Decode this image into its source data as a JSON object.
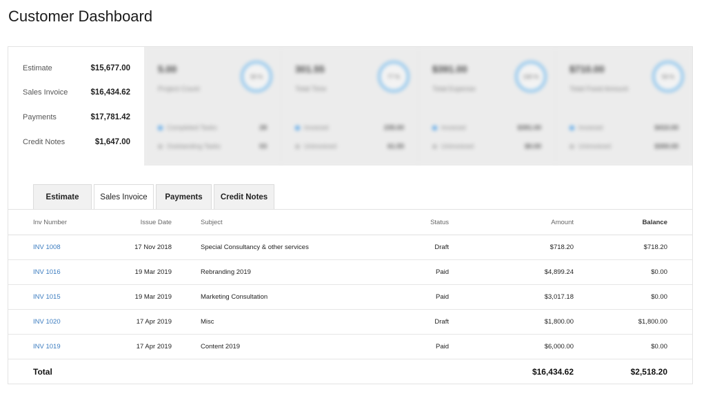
{
  "page": {
    "title": "Customer Dashboard"
  },
  "summary": [
    {
      "label": "Estimate",
      "value": "$15,677.00"
    },
    {
      "label": "Sales Invoice",
      "value": "$16,434.62"
    },
    {
      "label": "Payments",
      "value": "$17,781.42"
    },
    {
      "label": "Credit Notes",
      "value": "$1,647.00"
    }
  ],
  "kpis": [
    {
      "big": "5.00",
      "sub": "Project Count",
      "ring": "30 %",
      "ring_color": "#8ec6ee",
      "legend": [
        {
          "label": "Completed Tasks",
          "value": "28",
          "color": "#5aa7e8"
        },
        {
          "label": "Outstanding Tasks",
          "value": "03",
          "color": "#bbbbbb"
        }
      ]
    },
    {
      "big": "301.55",
      "sub": "Total Time",
      "ring": "77 %",
      "ring_color": "#8ec6ee",
      "legend": [
        {
          "label": "Invoiced",
          "value": "235.00",
          "color": "#5aa7e8"
        },
        {
          "label": "Uninvoiced",
          "value": "61.55",
          "color": "#bbbbbb"
        }
      ]
    },
    {
      "big": "$391.00",
      "sub": "Total Expense",
      "ring": "100 %",
      "ring_color": "#8ec6ee",
      "legend": [
        {
          "label": "Invoiced",
          "value": "$391.00",
          "color": "#5aa7e8"
        },
        {
          "label": "Uninvoiced",
          "value": "$0.00",
          "color": "#bbbbbb"
        }
      ]
    },
    {
      "big": "$710.00",
      "sub": "Total Fixed Amount",
      "ring": "56 %",
      "ring_color": "#8ec6ee",
      "legend": [
        {
          "label": "Invoiced",
          "value": "$410.00",
          "color": "#5aa7e8"
        },
        {
          "label": "Uninvoiced",
          "value": "$300.00",
          "color": "#bbbbbb"
        }
      ]
    }
  ],
  "tabs": [
    "Estimate",
    "Sales Invoice",
    "Payments",
    "Credit Notes"
  ],
  "active_tab": "Sales Invoice",
  "table": {
    "headers": {
      "inv_number": "Inv Number",
      "issue_date": "Issue Date",
      "subject": "Subject",
      "status": "Status",
      "amount": "Amount",
      "balance": "Balance"
    },
    "rows": [
      {
        "inv": "INV 1008",
        "date": "17 Nov 2018",
        "subject": "Special Consultancy & other services",
        "status": "Draft",
        "amount": "$718.20",
        "balance": "$718.20"
      },
      {
        "inv": "INV 1016",
        "date": "19 Mar 2019",
        "subject": "Rebranding 2019",
        "status": "Paid",
        "amount": "$4,899.24",
        "balance": "$0.00"
      },
      {
        "inv": "INV 1015",
        "date": "19 Mar 2019",
        "subject": "Marketing Consultation",
        "status": "Paid",
        "amount": "$3,017.18",
        "balance": "$0.00"
      },
      {
        "inv": "INV 1020",
        "date": "17 Apr 2019",
        "subject": "Misc",
        "status": "Draft",
        "amount": "$1,800.00",
        "balance": "$1,800.00"
      },
      {
        "inv": "INV 1019",
        "date": "17 Apr 2019",
        "subject": "Content 2019",
        "status": "Paid",
        "amount": "$6,000.00",
        "balance": "$0.00"
      }
    ],
    "total": {
      "label": "Total",
      "amount": "$16,434.62",
      "balance": "$2,518.20"
    }
  },
  "colors": {
    "link": "#3a7bbf",
    "paid": "#3aa83a",
    "ring": "#8ec6ee"
  }
}
